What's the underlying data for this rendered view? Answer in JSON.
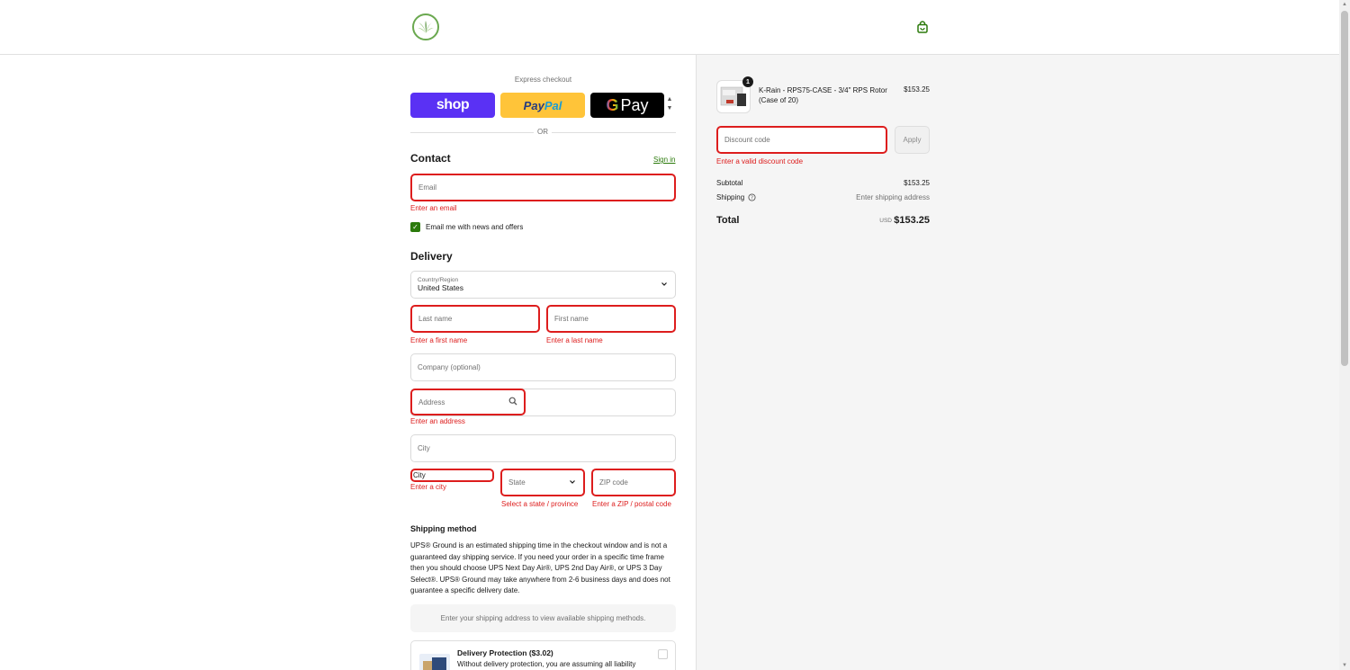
{
  "header": {
    "logo_icon": "grass-logo-icon",
    "cart_icon": "shopping-bag-icon",
    "brand_color": "#6aa84f"
  },
  "express": {
    "label": "Express checkout",
    "shop_label": "shop",
    "paypal_label_pay": "Pay",
    "paypal_label_pal": "Pal",
    "gpay_label": "Pay",
    "or_label": "OR"
  },
  "contact": {
    "title": "Contact",
    "signin_label": "Sign in",
    "email_placeholder": "Email",
    "email_error": "Enter an email",
    "newsletter_label": "Email me with news and offers",
    "newsletter_checked": true
  },
  "delivery": {
    "title": "Delivery",
    "country_label": "Country/Region",
    "country_value": "United States",
    "last_name_placeholder": "Last name",
    "first_name_placeholder": "First name",
    "last_name_error": "Enter a first name",
    "first_name_error": "Enter a last name",
    "company_placeholder": "Company (optional)",
    "address_placeholder": "Address",
    "address_error": "Enter an address",
    "city_placeholder": "City",
    "city_small_value": "City",
    "city_error": "Enter a city",
    "state_placeholder": "State",
    "state_error": "Select a state / province",
    "zip_placeholder": "ZIP code",
    "zip_error": "Enter a ZIP / postal code"
  },
  "shipping": {
    "title": "Shipping method",
    "description": "UPS® Ground is an estimated shipping time in the checkout window and is not a guaranteed day shipping service. If you need your order in a specific time frame then you should choose UPS Next Day Air®, UPS 2nd Day Air®, or UPS 3 Day Select®. UPS® Ground may take anywhere from 2-6 business days and does not guarantee a specific delivery date.",
    "placeholder_box": "Enter your shipping address to view available shipping methods.",
    "protection_title": "Delivery Protection ($3.02)",
    "protection_desc": "Without delivery protection, you are assuming all liability"
  },
  "summary": {
    "item_qty": "1",
    "item_name": "K-Rain - RPS75-CASE - 3/4\" RPS Rotor (Case of 20)",
    "item_price": "$153.25",
    "discount_placeholder": "Discount code",
    "apply_label": "Apply",
    "discount_error": "Enter a valid discount code",
    "subtotal_label": "Subtotal",
    "subtotal_value": "$153.25",
    "shipping_label": "Shipping",
    "shipping_value": "Enter shipping address",
    "total_label": "Total",
    "currency": "USD",
    "total_value": "$153.25"
  },
  "colors": {
    "error": "#dd1d1d",
    "accent": "#2b7a0b",
    "shop": "#5a31f4",
    "paypal": "#ffc439"
  }
}
